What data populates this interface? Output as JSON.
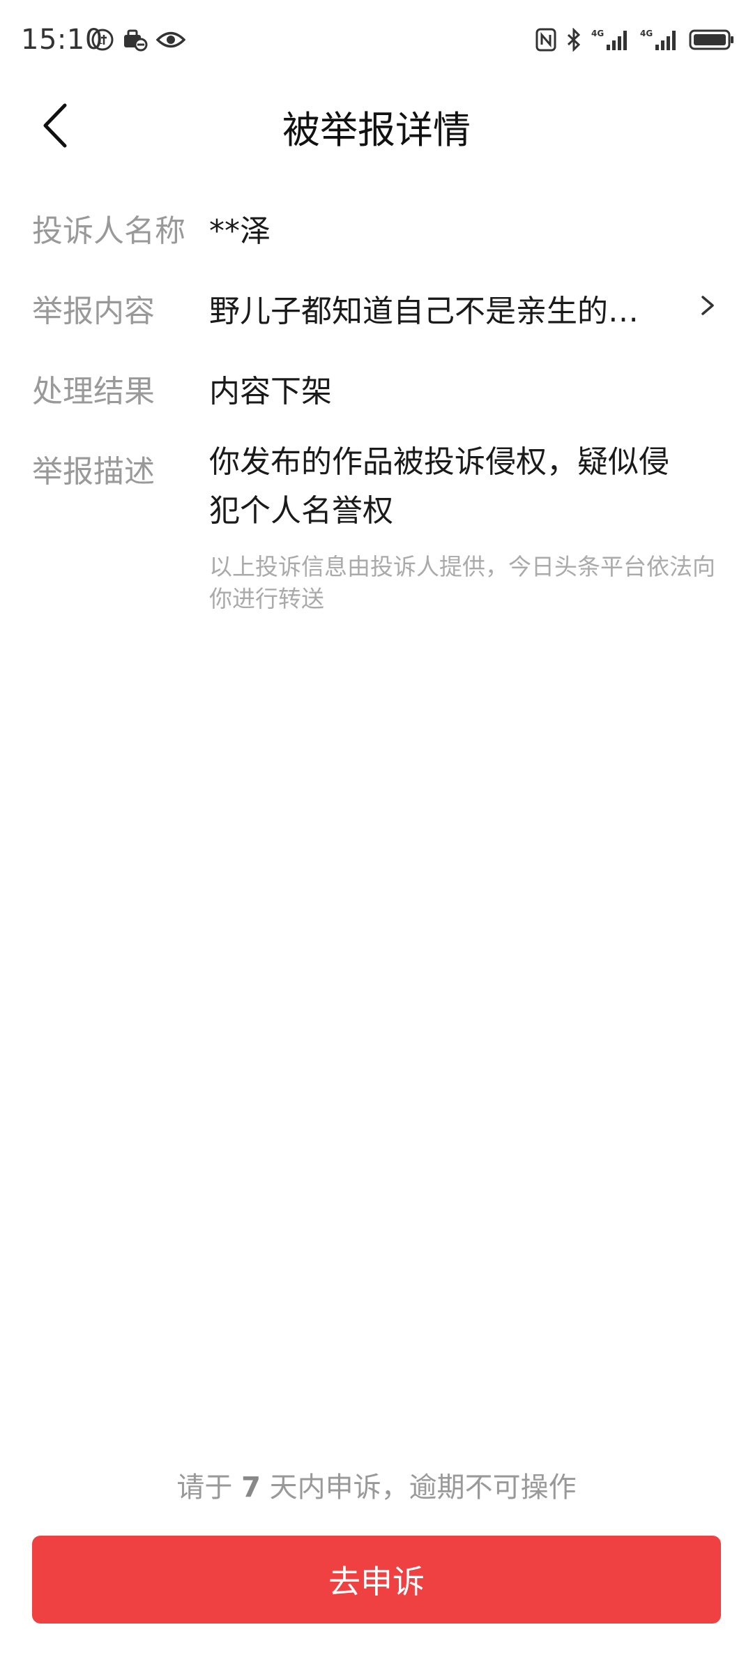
{
  "status_bar": {
    "time": "15:10",
    "left_icons": [
      "usb-debug-icon",
      "vpn-icon",
      "eye-icon"
    ],
    "right_icons": [
      "nfc-icon",
      "bluetooth-icon",
      "signal-4g-1-icon",
      "signal-4g-2-icon",
      "battery-icon"
    ],
    "network_label": "4G"
  },
  "header": {
    "title": "被举报详情"
  },
  "details": {
    "complainant": {
      "label": "投诉人名称",
      "value": "**泽"
    },
    "content": {
      "label": "举报内容",
      "value": "野儿子都知道自己不是亲生的…"
    },
    "result": {
      "label": "处理结果",
      "value": "内容下架"
    },
    "description": {
      "label": "举报描述",
      "value": "你发布的作品被投诉侵权，疑似侵犯个人名誉权",
      "note": "以上投诉信息由投诉人提供，今日头条平台依法向你进行转送"
    }
  },
  "footer": {
    "notice_prefix": "请于 ",
    "notice_days": "7",
    "notice_suffix": " 天内申诉，逾期不可操作",
    "appeal_button": "去申诉"
  },
  "colors": {
    "accent": "#f04142",
    "label": "#999999",
    "text": "#1a1a1a"
  }
}
